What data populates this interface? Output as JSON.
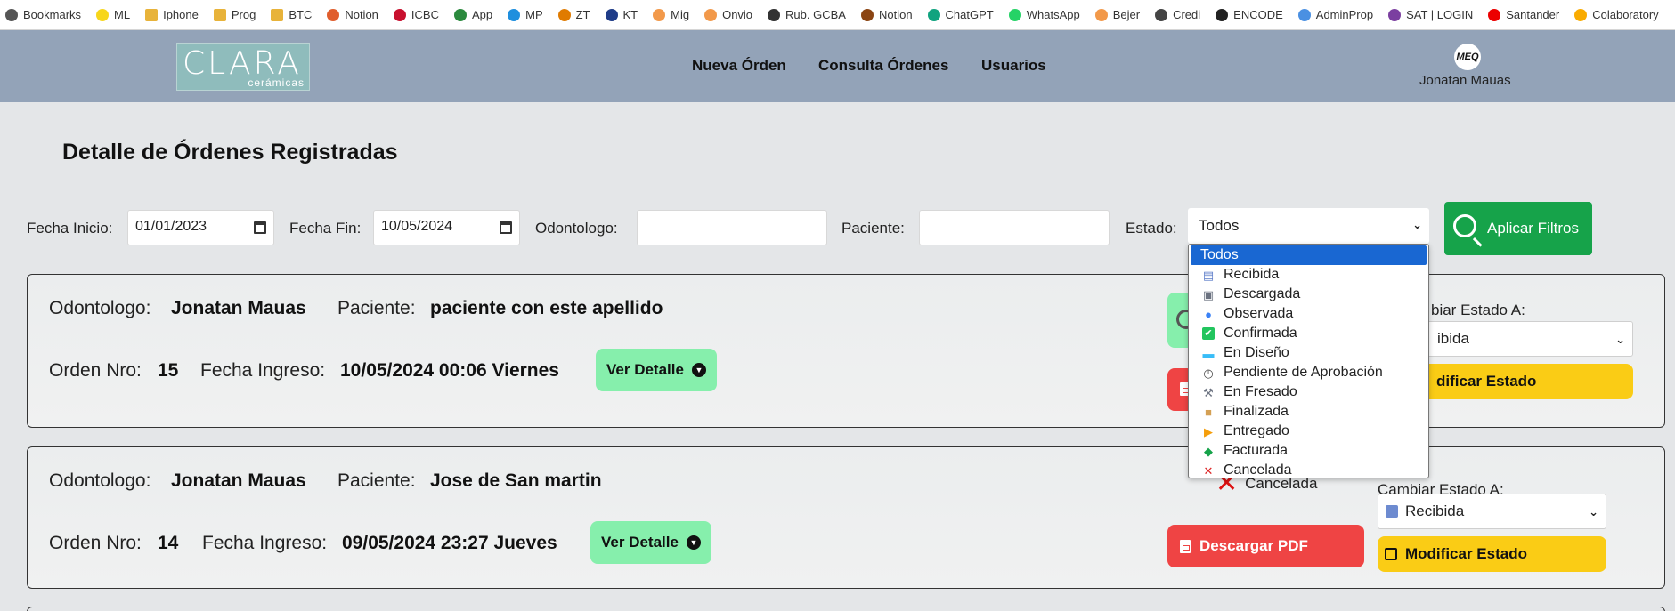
{
  "bookmarks": [
    {
      "label": "Bookmarks",
      "icon": "bookmark-icon",
      "color": "#555555"
    },
    {
      "label": "ML",
      "icon": "mercadolibre-icon",
      "color": "#f7d61b"
    },
    {
      "label": "Iphone",
      "icon": "folder-icon",
      "color": "#e8b33a"
    },
    {
      "label": "Prog",
      "icon": "folder-icon",
      "color": "#e8b33a"
    },
    {
      "label": "BTC",
      "icon": "folder-icon",
      "color": "#e8b33a"
    },
    {
      "label": "Notion",
      "icon": "list-icon",
      "color": "#e05d2c"
    },
    {
      "label": "ICBC",
      "icon": "icbc-icon",
      "color": "#c8102e"
    },
    {
      "label": "App",
      "icon": "app-icon",
      "color": "#2b8a3e"
    },
    {
      "label": "MP",
      "icon": "mercadopago-icon",
      "color": "#1f8fde"
    },
    {
      "label": "ZT",
      "icon": "zt-icon",
      "color": "#e07b00"
    },
    {
      "label": "KT",
      "icon": "kt-icon",
      "color": "#1f3c88"
    },
    {
      "label": "Mig",
      "icon": "mig-icon",
      "color": "#f2994a"
    },
    {
      "label": "Onvio",
      "icon": "onvio-icon",
      "color": "#f2994a"
    },
    {
      "label": "Rub. GCBA",
      "icon": "globe-icon",
      "color": "#333333"
    },
    {
      "label": "Notion",
      "icon": "notion-icon",
      "color": "#8b4513"
    },
    {
      "label": "ChatGPT",
      "icon": "chatgpt-icon",
      "color": "#10a37f"
    },
    {
      "label": "WhatsApp",
      "icon": "whatsapp-icon",
      "color": "#25d366"
    },
    {
      "label": "Bejer",
      "icon": "bejer-icon",
      "color": "#f2994a"
    },
    {
      "label": "Credi",
      "icon": "credi-icon",
      "color": "#444444"
    },
    {
      "label": "ENCODE",
      "icon": "globe-icon",
      "color": "#222222"
    },
    {
      "label": "AdminProp",
      "icon": "adminprop-icon",
      "color": "#4a90e2"
    },
    {
      "label": "SAT | LOGIN",
      "icon": "sat-icon",
      "color": "#7b3fa0"
    },
    {
      "label": "Santander",
      "icon": "santander-icon",
      "color": "#ec0000"
    },
    {
      "label": "Colaboratory",
      "icon": "colab-icon",
      "color": "#f9ab00"
    }
  ],
  "header": {
    "logo_text": "CLARA",
    "logo_sub": "cerámicas",
    "nav": [
      "Nueva Órden",
      "Consulta Órdenes",
      "Usuarios"
    ],
    "avatar_text": "MEQ",
    "user_name": "Jonatan Mauas"
  },
  "page": {
    "title": "Detalle de Órdenes Registradas"
  },
  "filters": {
    "start_label": "Fecha Inicio:",
    "start_value": "01/01/2023",
    "end_label": "Fecha Fin:",
    "end_value": "10/05/2024",
    "dentist_label": "Odontologo:",
    "dentist_value": "",
    "patient_label": "Paciente:",
    "patient_value": "",
    "state_label": "Estado:",
    "state_value": "Todos",
    "apply_label": "Aplicar Filtros"
  },
  "dropdown": {
    "options": [
      {
        "label": "Todos",
        "icon": "",
        "selected": true
      },
      {
        "label": "Recibida",
        "icon": "inbox-icon"
      },
      {
        "label": "Descargada",
        "icon": "printer-icon"
      },
      {
        "label": "Observada",
        "icon": "magnifier-icon"
      },
      {
        "label": "Confirmada",
        "icon": "check-icon"
      },
      {
        "label": "En Diseño",
        "icon": "monitor-icon"
      },
      {
        "label": "Pendiente de Aprobación",
        "icon": "clock-icon"
      },
      {
        "label": "En Fresado",
        "icon": "tools-icon"
      },
      {
        "label": "Finalizada",
        "icon": "package-icon"
      },
      {
        "label": "Entregado",
        "icon": "truck-icon"
      },
      {
        "label": "Facturada",
        "icon": "money-icon"
      },
      {
        "label": "Cancelada",
        "icon": "cross-icon"
      }
    ]
  },
  "orders": [
    {
      "dentist_label": "Odontologo:",
      "dentist": "Jonatan Mauas",
      "patient_label": "Paciente:",
      "patient": "paciente con este apellido",
      "order_label": "Orden Nro:",
      "order_no": "15",
      "date_label": "Fecha Ingreso:",
      "date": "10/05/2024 00:06 Viernes",
      "detail_label": "Ver Detalle",
      "change_label": "Cambiar Estado A:",
      "change_visible": "biar Estado A:",
      "change_value_visible": "ibida",
      "modify_visible": "dificar Estado"
    },
    {
      "dentist_label": "Odontologo:",
      "dentist": "Jonatan Mauas",
      "patient_label": "Paciente:",
      "patient": "Jose de San martin",
      "order_label": "Orden Nro:",
      "order_no": "14",
      "date_label": "Fecha Ingreso:",
      "date": "09/05/2024 23:27 Jueves",
      "detail_label": "Ver Detalle",
      "status": "Cancelada",
      "pdf_label": "Descargar PDF",
      "change_label": "Cambiar Estado A:",
      "change_value": "Recibida",
      "modify_label": "Modificar Estado"
    }
  ]
}
